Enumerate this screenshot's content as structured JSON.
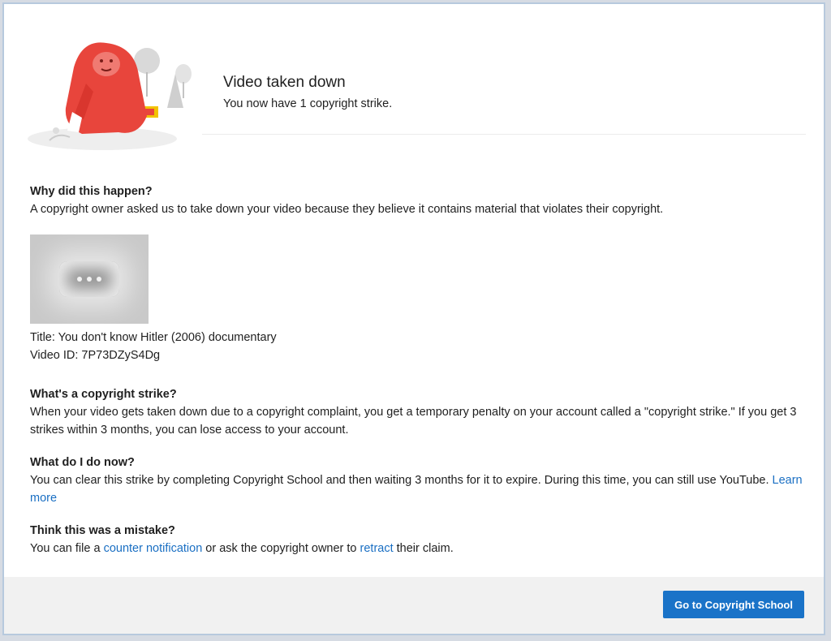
{
  "header": {
    "title": "Video taken down",
    "subtitle": "You now have 1 copyright strike."
  },
  "why": {
    "heading": "Why did this happen?",
    "body": "A copyright owner asked us to take down your video because they believe it contains material that violates their copyright."
  },
  "video": {
    "title_line": "Title: You don't know Hitler (2006) documentary",
    "id_line": "Video ID: 7P73DZyS4Dg",
    "thumbnail_icon": "more-horizontal-icon"
  },
  "strike_info": {
    "heading": "What's a copyright strike?",
    "body": "When your video gets taken down due to a copyright complaint, you get a temporary penalty on your account called a \"copyright strike.\" If you get 3 strikes within 3 months, you can lose access to your account."
  },
  "what_now": {
    "heading": "What do I do now?",
    "body": "You can clear this strike by completing Copyright School and then waiting 3 months for it to expire. During this time, you can still use YouTube. ",
    "learn_more": "Learn more"
  },
  "mistake": {
    "heading": "Think this was a mistake?",
    "body_prefix": "You can file a ",
    "counter_link": "counter notification",
    "body_mid": " or ask the copyright owner to ",
    "retract_link": "retract",
    "body_suffix": " their claim."
  },
  "footer": {
    "button_label": "Go to Copyright School"
  },
  "colors": {
    "link": "#1a6fc3",
    "button": "#1a73c8",
    "illustration_red": "#e8453c"
  }
}
